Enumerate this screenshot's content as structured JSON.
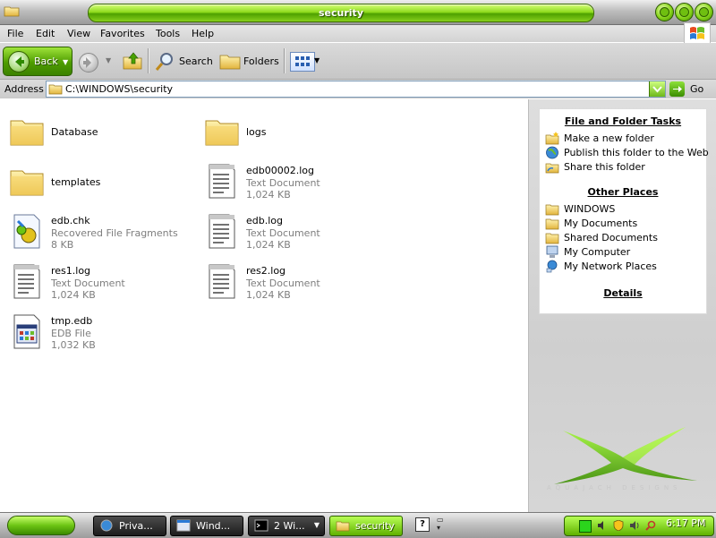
{
  "window": {
    "title": "security"
  },
  "menu": {
    "items": [
      "File",
      "Edit",
      "View",
      "Favorites",
      "Tools",
      "Help"
    ]
  },
  "toolbar": {
    "back_label": "Back",
    "search_label": "Search",
    "folders_label": "Folders"
  },
  "address": {
    "label": "Address",
    "path": "C:\\WINDOWS\\security",
    "go_label": "Go"
  },
  "files": [
    {
      "name": "Database",
      "kind": "folder"
    },
    {
      "name": "logs",
      "kind": "folder"
    },
    {
      "name": "templates",
      "kind": "folder"
    },
    {
      "name": "edb00002.log",
      "type": "Text Document",
      "size": "1,024 KB",
      "kind": "text"
    },
    {
      "name": "edb.chk",
      "type": "Recovered File Fragments",
      "size": "8 KB",
      "kind": "chk"
    },
    {
      "name": "edb.log",
      "type": "Text Document",
      "size": "1,024 KB",
      "kind": "text"
    },
    {
      "name": "res1.log",
      "type": "Text Document",
      "size": "1,024 KB",
      "kind": "text"
    },
    {
      "name": "res2.log",
      "type": "Text Document",
      "size": "1,024 KB",
      "kind": "text"
    },
    {
      "name": "tmp.edb",
      "type": "EDB File",
      "size": "1,032 KB",
      "kind": "edb"
    }
  ],
  "taskpane": {
    "file_tasks_title": "File and Folder Tasks",
    "file_tasks": [
      "Make a new folder",
      "Publish this folder to the Web",
      "Share this folder"
    ],
    "other_places_title": "Other Places",
    "other_places": [
      "WINDOWS",
      "My Documents",
      "Shared Documents",
      "My Computer",
      "My Network Places"
    ],
    "details_title": "Details",
    "brand": "AQUAJACH DESIGNS"
  },
  "taskbar": {
    "buttons": [
      "Priva...",
      "Wind...",
      "2 Wi...",
      "security"
    ],
    "clock": "6:17 PM"
  },
  "colors": {
    "accent_green": "#6cc414",
    "title_green": "#8fdc1c"
  }
}
